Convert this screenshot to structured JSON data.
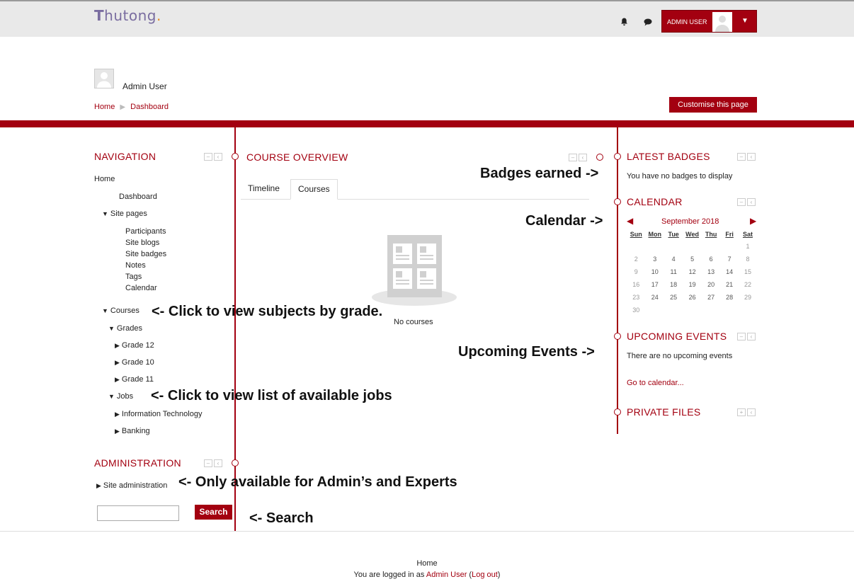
{
  "header": {
    "logo_text": "hutong",
    "logo_letter": "T",
    "logo_dot": ".",
    "user_menu_name": "ADMIN USER"
  },
  "profile": {
    "full_name": "Admin User"
  },
  "breadcrumb": [
    "Home",
    "Dashboard"
  ],
  "customise_button": "Customise this page",
  "navigation": {
    "title": "NAVIGATION",
    "home": "Home",
    "dashboard": "Dashboard",
    "site_pages": "Site pages",
    "site_page_items": [
      "Participants",
      "Site blogs",
      "Site badges",
      "Notes",
      "Tags",
      "Calendar"
    ],
    "courses": "Courses",
    "grades": "Grades",
    "grade_items": [
      "Grade 12",
      "Grade 10",
      "Grade 11"
    ],
    "jobs": "Jobs",
    "job_items": [
      "Information Technology",
      "Banking"
    ]
  },
  "administration": {
    "title": "ADMINISTRATION",
    "site_admin": "Site administration"
  },
  "search_button": "Search",
  "course_overview": {
    "title": "COURSE OVERVIEW",
    "tabs": [
      "Timeline",
      "Courses"
    ],
    "active_tab": "Courses",
    "empty_text": "No courses"
  },
  "latest_badges": {
    "title": "LATEST BADGES",
    "text": "You have no badges to display"
  },
  "calendar": {
    "title": "CALENDAR",
    "month": "September 2018",
    "days": [
      "Sun",
      "Mon",
      "Tue",
      "Wed",
      "Thu",
      "Fri",
      "Sat"
    ],
    "weeks": [
      [
        "",
        "",
        "",
        "",
        "",
        "",
        "1"
      ],
      [
        "2",
        "3",
        "4",
        "5",
        "6",
        "7",
        "8"
      ],
      [
        "9",
        "10",
        "11",
        "12",
        "13",
        "14",
        "15"
      ],
      [
        "16",
        "17",
        "18",
        "19",
        "20",
        "21",
        "22"
      ],
      [
        "23",
        "24",
        "25",
        "26",
        "27",
        "28",
        "29"
      ],
      [
        "30",
        "",
        "",
        "",
        "",
        "",
        ""
      ]
    ]
  },
  "upcoming_events": {
    "title": "UPCOMING EVENTS",
    "text": "There are no upcoming events",
    "link": "Go to calendar..."
  },
  "private_files": {
    "title": "PRIVATE FILES"
  },
  "annotations": {
    "badges": "Badges earned ->",
    "calendar": "Calendar ->",
    "courses": "<- Click to view subjects by grade.",
    "jobs": "<- Click to view list of available jobs",
    "events": "Upcoming Events ->",
    "admin": "<- Only available for Admin’s and Experts",
    "search": "<- Search"
  },
  "footer": {
    "home": "Home",
    "logged_prefix": "You are logged in as ",
    "user": "Admin User",
    "logout_open": " (",
    "logout": "Log out",
    "logout_close": ")"
  },
  "colors": {
    "brand_red": "#a30010",
    "header_bg": "#e9e9e9"
  }
}
